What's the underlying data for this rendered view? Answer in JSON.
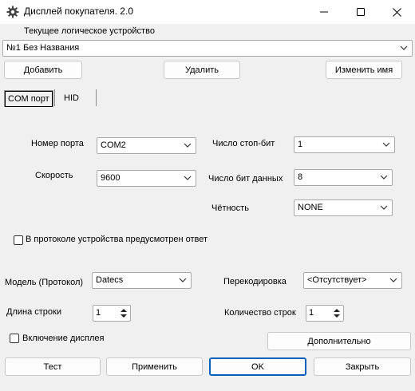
{
  "window": {
    "title": "Дисплей покупателя. 2.0",
    "icon": "gear-icon",
    "controls": [
      "minimize-icon",
      "maximize-icon",
      "close-icon"
    ]
  },
  "device": {
    "label": "Текущее логическое устройство",
    "selected": "№1 Без Названия",
    "add_label": "Добавить",
    "delete_label": "Удалить",
    "rename_label": "Изменить имя"
  },
  "tabs": [
    {
      "label": "COM порт",
      "active": true
    },
    {
      "label": "HID",
      "active": false
    }
  ],
  "com": {
    "port_label": "Номер порта",
    "port_value": "COM2",
    "speed_label": "Скорость",
    "speed_value": "9600",
    "stopbits_label": "Число стоп-бит",
    "stopbits_value": "1",
    "databits_label": "Число бит данных",
    "databits_value": "8",
    "parity_label": "Чётность",
    "parity_value": "NONE",
    "reply_checkbox_label": "В протоколе устройства предусмотрен ответ",
    "reply_checked": false
  },
  "settings": {
    "model_label": "Модель (Протокол)",
    "model_value": "Datecs",
    "recode_label": "Перекодировка",
    "recode_value": "<Отсутствует>",
    "line_length_label": "Длина строки",
    "line_length_value": "1",
    "line_count_label": "Количество строк",
    "line_count_value": "1",
    "display_on_label": "Включение дисплея",
    "display_on_checked": false,
    "advanced_label": "Дополнительно"
  },
  "footer": {
    "test_label": "Тест",
    "apply_label": "Применить",
    "ok_label": "OK",
    "close_label": "Закрыть"
  },
  "colors": {
    "window_bg": "#f0f0f0",
    "titlebar_bg": "#ffffff",
    "accent": "#005fb8",
    "border": "#a9a9a9"
  }
}
